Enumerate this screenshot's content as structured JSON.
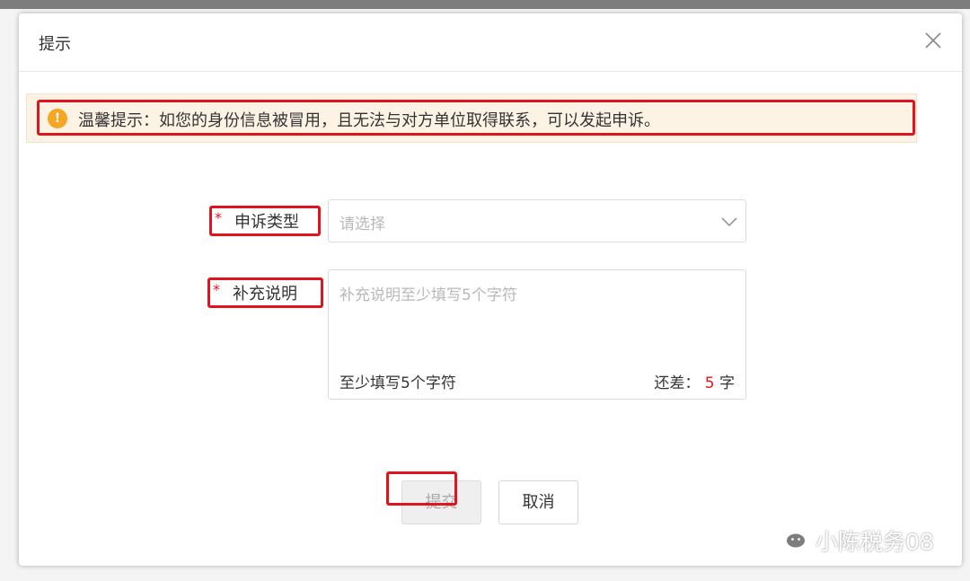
{
  "dialog": {
    "title": "提示",
    "close_icon": "close-icon"
  },
  "tip": {
    "icon": "warning-icon",
    "icon_glyph": "!",
    "text": "温馨提示：如您的身份信息被冒用，且无法与对方单位取得联系，可以发起申诉。"
  },
  "form": {
    "required_mark": "*",
    "appeal_type": {
      "label": "申诉类型",
      "placeholder": "请选择"
    },
    "supplement": {
      "label": "补充说明",
      "placeholder": "补充说明至少填写5个字符",
      "hint": "至少填写5个字符",
      "remaining_prefix": "还差：",
      "remaining_count": "5",
      "remaining_suffix": "字"
    }
  },
  "buttons": {
    "submit": "提交",
    "cancel": "取消"
  },
  "watermark": {
    "text": "小陈税务08"
  },
  "colors": {
    "highlight": "#e0141e",
    "tip_background": "#fdf3e5",
    "warning": "#f5a623"
  }
}
